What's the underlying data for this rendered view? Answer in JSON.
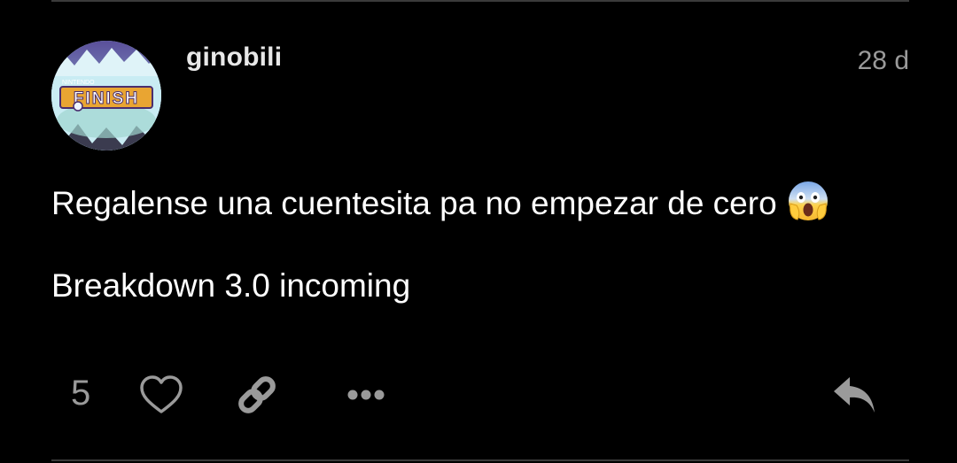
{
  "post": {
    "author": {
      "username": "ginobili",
      "avatar_text_small": "NINTENDO",
      "avatar_text_big": "FINISH"
    },
    "timestamp": "28 d",
    "lines": [
      "Regalense una cuentesita pa no empezar de cero",
      "Breakdown 3.0 incoming"
    ],
    "emoji": "face-screaming-in-fear",
    "likes": "5"
  },
  "actions": {
    "icons": [
      "heart-icon",
      "link-icon",
      "more-icon",
      "reply-icon"
    ]
  },
  "colors": {
    "background": "#000000",
    "text": "#ffffff",
    "muted": "#9a9a9a",
    "divider": "#3a3a3a"
  }
}
